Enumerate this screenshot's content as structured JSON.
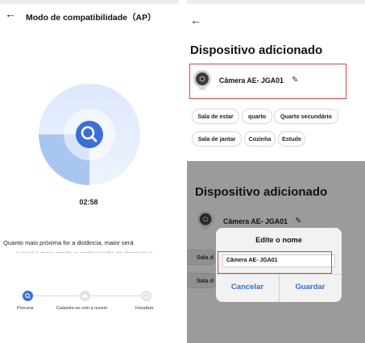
{
  "colors": {
    "accent": "#2f6fd6",
    "highlight_border": "#d9443f",
    "overlay_bg": "#9b9b9b"
  },
  "left": {
    "back_icon": "←",
    "title": "Modo de compatibilidade（AP）",
    "scan_icon": "search-icon",
    "timer": "02:58",
    "info_text": "Quanto mais próxima for a distância, maior será",
    "info_text_partial": "o sinal e mais rápida a configuração do dispositivo",
    "steps": [
      {
        "label": "Procurar",
        "icon": "magnifier-icon"
      },
      {
        "label": "Cadastre-se com a nuvem",
        "icon": "cloud-icon"
      },
      {
        "label": "Inicializar",
        "icon": "smile-icon"
      }
    ]
  },
  "right_top": {
    "back_icon": "←",
    "title": "Dispositivo adicionado",
    "device_name": "Câmera AE- JGA01",
    "edit_icon": "✎",
    "rooms": [
      "Sala de estar",
      "quarto",
      "Quarto secundário",
      "Sala de jantar",
      "Cozinha",
      "Estude"
    ]
  },
  "right_bottom": {
    "title": "Dispositivo adicionado",
    "device_name": "Câmera AE- JGA01",
    "edit_icon": "✎",
    "rooms_partial": [
      "Sala d",
      "Sala d"
    ],
    "dialog": {
      "title": "Edite o nome",
      "input_value": "Câmera AE- JGA01",
      "cancel_label": "Cancelar",
      "save_label": "Guardar"
    }
  }
}
